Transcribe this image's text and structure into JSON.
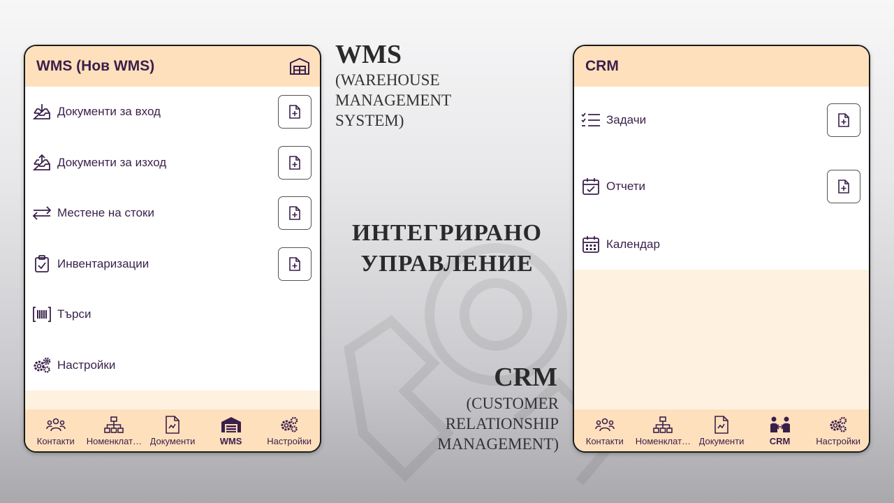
{
  "colors": {
    "header_bg": "#ffe0bd",
    "filler_bg": "#fff1e0",
    "text": "#3a1f4a"
  },
  "wms_app": {
    "title": "WMS (Нов WMS)",
    "header_icon": "warehouse-icon",
    "menu": [
      {
        "label": "Документи за вход",
        "icon": "inbox-in-icon",
        "has_add": true
      },
      {
        "label": "Документи за изход",
        "icon": "inbox-out-icon",
        "has_add": true
      },
      {
        "label": "Местене на стоки",
        "icon": "transfer-arrows-icon",
        "has_add": true
      },
      {
        "label": "Инвентаризации",
        "icon": "clipboard-check-icon",
        "has_add": true
      },
      {
        "label": "Търси",
        "icon": "barcode-scan-icon",
        "has_add": false
      },
      {
        "label": "Настройки",
        "icon": "gears-icon",
        "has_add": false
      }
    ],
    "nav": [
      {
        "label": "Контакти",
        "icon": "people-icon",
        "active": false
      },
      {
        "label": "Номенклат…",
        "icon": "hierarchy-icon",
        "active": false
      },
      {
        "label": "Документи",
        "icon": "document-icon",
        "active": false
      },
      {
        "label": "WMS",
        "icon": "warehouse-icon",
        "active": true
      },
      {
        "label": "Настройки",
        "icon": "gears-icon",
        "active": false
      }
    ]
  },
  "crm_app": {
    "title": "CRM",
    "menu": [
      {
        "label": "Задачи",
        "icon": "checklist-icon",
        "has_add": true
      },
      {
        "label": "Отчети",
        "icon": "calendar-check-icon",
        "has_add": true
      },
      {
        "label": "Календар",
        "icon": "calendar-grid-icon",
        "has_add": false
      }
    ],
    "nav": [
      {
        "label": "Контакти",
        "icon": "people-icon",
        "active": false
      },
      {
        "label": "Номенклат…",
        "icon": "hierarchy-icon",
        "active": false
      },
      {
        "label": "Документи",
        "icon": "document-icon",
        "active": false
      },
      {
        "label": "CRM",
        "icon": "handshake-people-icon",
        "active": true
      },
      {
        "label": "Настройки",
        "icon": "gears-icon",
        "active": false
      }
    ]
  },
  "captions": {
    "wms_heading": "WMS",
    "wms_sub_line1": "(Warehouse",
    "wms_sub_line2": "Management",
    "wms_sub_line3": "System)",
    "center_line1": "ИНТЕГРИРАНО",
    "center_line2": "УПРАВЛЕНИЕ",
    "crm_heading": "CRM",
    "crm_sub_line1": "(Customer",
    "crm_sub_line2": "Relationship",
    "crm_sub_line3": "Management)"
  }
}
